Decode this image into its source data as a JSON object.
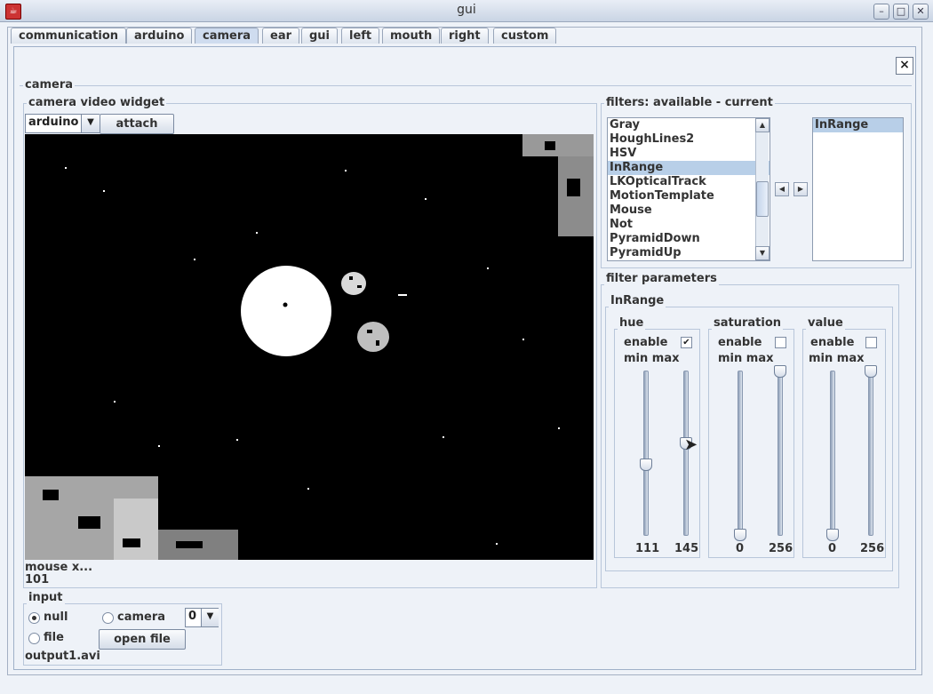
{
  "window": {
    "title": "gui"
  },
  "tabs": [
    "communication",
    "arduino",
    "camera",
    "ear",
    "gui",
    "left",
    "mouth",
    "right",
    "custom"
  ],
  "active_tab": "camera",
  "panel": {
    "title": "camera",
    "video_widget": {
      "title": "camera  video widget",
      "source_select": "arduino",
      "attach_label": "attach",
      "mouse_label": "mouse x...",
      "mouse_value": "101"
    },
    "input": {
      "title": "input",
      "null_label": "null",
      "camera_label": "camera",
      "camera_index": "0",
      "file_label": "file",
      "open_file_label": "open file",
      "filename": "output1.avi",
      "selected": "null"
    },
    "filters": {
      "title": "filters: available - current",
      "available": [
        "Gray",
        "HoughLines2",
        "HSV",
        "InRange",
        "LKOpticalTrack",
        "MotionTemplate",
        "Mouse",
        "Not",
        "PyramidDown",
        "PyramidUp"
      ],
      "selected_available": "InRange",
      "current": [
        "InRange"
      ],
      "add_icon": "arrow-left-icon",
      "remove_icon": "arrow-right-icon"
    },
    "filter_parameters": {
      "title": "filter parameters",
      "filter_name": "InRange",
      "enable_label": "enable",
      "minmax_label": "min max",
      "channels": [
        {
          "name": "hue",
          "enabled": true,
          "min": "111",
          "max": "145",
          "min_level": 0.43,
          "max_level": 0.56
        },
        {
          "name": "saturation",
          "enabled": false,
          "min": "0",
          "max": "256",
          "min_level": 0.0,
          "max_level": 1.0
        },
        {
          "name": "value",
          "enabled": false,
          "min": "0",
          "max": "256",
          "min_level": 0.0,
          "max_level": 1.0
        }
      ]
    }
  },
  "colors": {
    "accent": "#b8cfe8",
    "background": "#eef2f8",
    "video_bg": "#000000"
  }
}
